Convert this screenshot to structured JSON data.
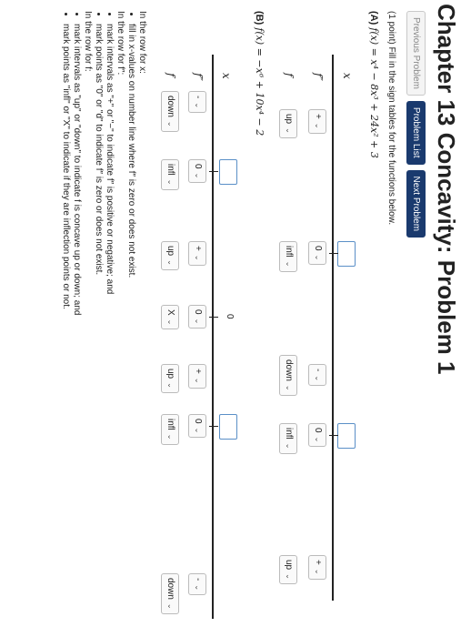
{
  "header": {
    "title": "Chapter 13 Concavity: Problem 1"
  },
  "nav": {
    "prev": "Previous Problem",
    "list": "Problem List",
    "next": "Next Problem"
  },
  "intro": "(1 point) Fill in the sign tables for the functions below.",
  "partA": {
    "label": "(A)",
    "function": "f(x) = x⁴ − 8x³ + 24x² + 3",
    "x_label": "x",
    "fpp_label": "f″",
    "f_label": "f",
    "signs": [
      "+",
      "0",
      "-",
      "0",
      "+"
    ],
    "f_behavior": [
      "up",
      "infl",
      "down",
      "infl",
      "up"
    ]
  },
  "partB": {
    "label": "(B)",
    "function": "f(x) = −x⁶ + 10x⁴ − 2",
    "x_label": "x",
    "fpp_label": "f″",
    "f_label": "f",
    "zero_label": "0",
    "signs": [
      "-",
      "0",
      "+",
      "0",
      "+",
      "0",
      "-"
    ],
    "f_behavior": [
      "down",
      "infl",
      "up",
      "X",
      "up",
      "infl",
      "down"
    ]
  },
  "instructions": {
    "x_row_title": "In the row for x:",
    "x_row_items": [
      "fill in x-values on number line where f″ is zero or does not exist."
    ],
    "fpp_row_title": "In the row for f″:",
    "fpp_row_items": [
      "mark intervals as \"+\" or \"−\" to indicate f″ is positive or negative; and",
      "mark points as \"0\" or \"d\" to indicate f″ is zero or does not exist."
    ],
    "f_row_title": "In the row for f:",
    "f_row_items": [
      "mark intervals as \"up\" or \"down\" to indicate f is concave up or down; and",
      "mark points as \"infl\" or \"X\" to indicate if they are inflection points or not."
    ]
  }
}
